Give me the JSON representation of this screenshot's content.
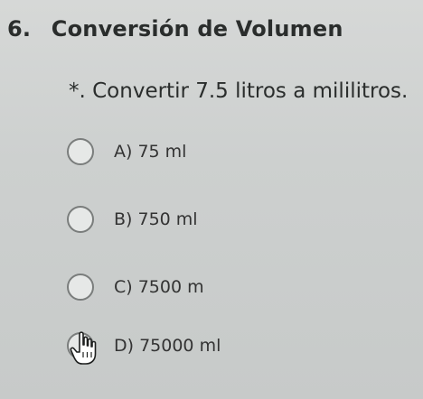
{
  "question": {
    "number": "6.",
    "title": "Conversión de Volumen",
    "prompt": "*. Convertir 7.5 litros a mililitros."
  },
  "options": [
    {
      "label": "A) 75 ml"
    },
    {
      "label": "B) 750 ml"
    },
    {
      "label": "C) 7500 m"
    },
    {
      "label": "D) 75000 ml"
    }
  ],
  "icons": {
    "radio": "radio-circle-icon",
    "cursor": "hand-pointer-icon"
  },
  "colors": {
    "background": "#cfd2d1",
    "text": "#2a2d2c"
  }
}
